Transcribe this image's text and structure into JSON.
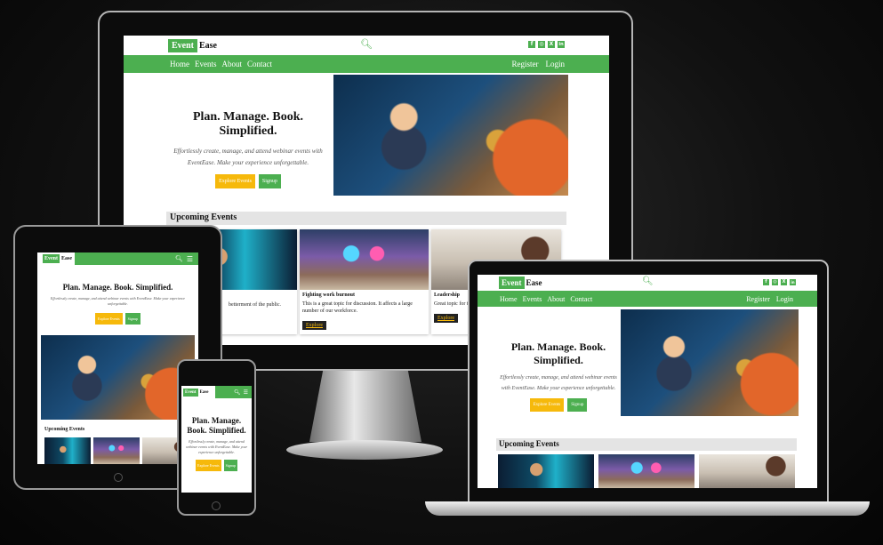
{
  "site": {
    "logo_part1": "Event",
    "logo_part2": "Ease",
    "nav": [
      "Home",
      "Events",
      "About",
      "Contact"
    ],
    "register": "Register",
    "login": "Login",
    "hero_title": "Plan. Manage. Book. Simplified.",
    "hero_title_line1": "Plan. Manage. Book.",
    "hero_title_line2": "Simplified.",
    "hero_sub": "Effortlessly create, manage, and attend webinar events with EventEase. Make your experience unforgettable.",
    "explore_events": "Explore Events",
    "signup": "Signup",
    "upcoming": "Upcoming Events",
    "cards": [
      {
        "title": "Fighting work burnout",
        "text": "This is a great topic for discussion. It affects a large number of our workforce.",
        "link": "Explore"
      },
      {
        "title": "Leadership",
        "text": "Great topic for those who want to become or",
        "link": "Explore"
      },
      {
        "text_fragment": "betterment of the public."
      }
    ]
  },
  "icons": {
    "social": [
      "facebook-icon",
      "instagram-icon",
      "x-icon",
      "linkedin-icon"
    ],
    "search": "search-icon",
    "menu": "hamburger-menu-icon"
  },
  "colors": {
    "brand_green": "#4caf50",
    "accent_yellow": "#f6b90b",
    "section_gray": "#e4e4e4"
  }
}
